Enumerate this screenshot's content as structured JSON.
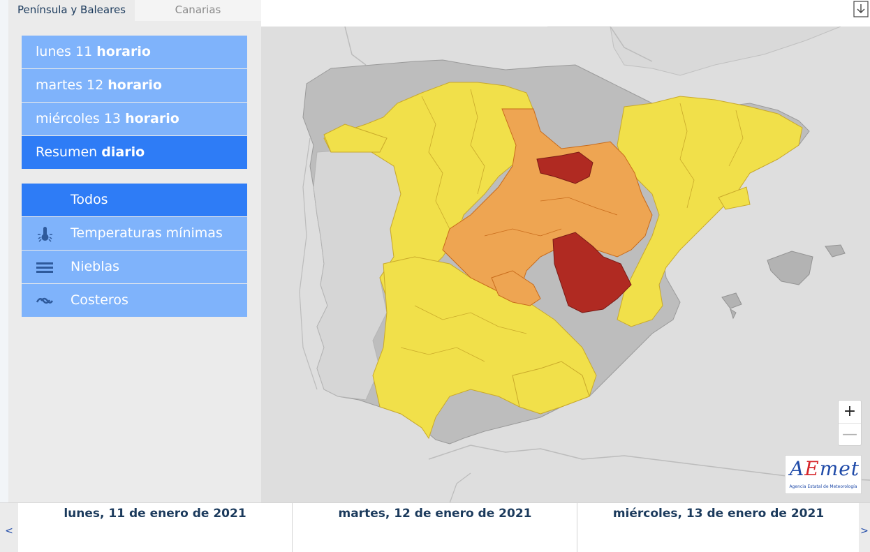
{
  "region_tabs": {
    "peninsula": "Península y Baleares",
    "canarias": "Canarias"
  },
  "days": [
    {
      "prefix": "lunes 11",
      "suffix": "horario",
      "active": false
    },
    {
      "prefix": "martes 12",
      "suffix": "horario",
      "active": false
    },
    {
      "prefix": "miércoles 13",
      "suffix": "horario",
      "active": false
    },
    {
      "prefix": "Resumen",
      "suffix": "diario",
      "active": true
    }
  ],
  "types": [
    {
      "label": "Todos",
      "icon": "none",
      "active": true
    },
    {
      "label": "Temperaturas mínimas",
      "icon": "thermometer-icon",
      "active": false
    },
    {
      "label": "Nieblas",
      "icon": "fog-icon",
      "active": false
    },
    {
      "label": "Costeros",
      "icon": "waves-icon",
      "active": false
    }
  ],
  "zoom": {
    "in": "+",
    "out": "—"
  },
  "logo": {
    "a": "A",
    "e": "E",
    "met": "met",
    "subtitle": "Agencia Estatal de Meteorología"
  },
  "date_bar": {
    "prev": "<",
    "next": ">",
    "dates": [
      "lunes, 11 de enero de 2021",
      "martes, 12 de enero de 2021",
      "miércoles, 13 de enero de 2021"
    ]
  },
  "colors": {
    "active_blue": "#2e7cf6",
    "light_blue": "#7fb3fb",
    "warning_yellow": "#f1e04a",
    "warning_orange": "#eea552",
    "warning_red": "#b02a22",
    "land_gray": "#bdbdbd",
    "sea_gray": "#dedede"
  },
  "map_legend_levels": [
    "yellow",
    "orange",
    "red"
  ]
}
